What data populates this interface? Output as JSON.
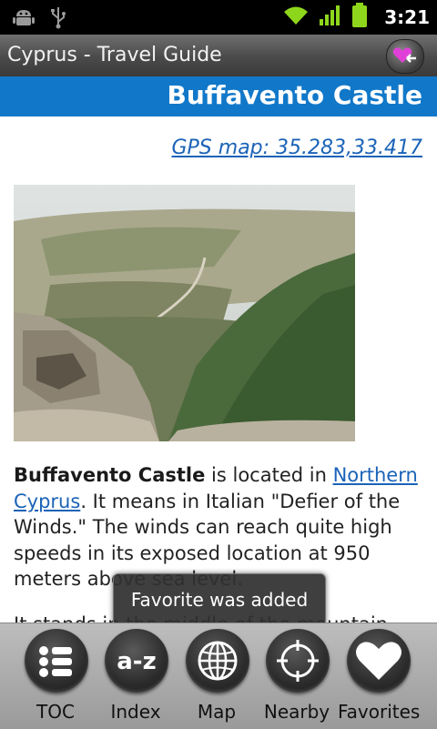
{
  "status_bar": {
    "time": "3:21",
    "icons": [
      "android-debug-icon",
      "usb-icon",
      "wifi-icon",
      "signal-icon",
      "battery-icon"
    ]
  },
  "app_bar": {
    "title": "Cyprus - Travel Guide",
    "favorite_button_icon": "heart-arrow-icon"
  },
  "page": {
    "title": "Buffavento Castle",
    "gps_link": "GPS map: 35.283,33.417",
    "photo_alt": "Buffavento Castle ruins on mountain ridge",
    "article": {
      "bold_name": "Buffavento Castle",
      "text1": " is located in ",
      "link_text": "Northern Cyprus",
      "text2": ". It means in Italian \"Defier of the Winds.\" The winds can reach quite high speeds in its exposed location at 950 meters above sea level.",
      "text3": "It stands in the middle of the mountain"
    }
  },
  "toast": {
    "message": "Favorite was added"
  },
  "toolbar": {
    "items": [
      {
        "label": "TOC",
        "icon": "list-icon"
      },
      {
        "label": "Index",
        "icon": "a-z-icon"
      },
      {
        "label": "Map",
        "icon": "globe-icon"
      },
      {
        "label": "Nearby",
        "icon": "crosshair-icon"
      },
      {
        "label": "Favorites",
        "icon": "heart-icon"
      }
    ]
  },
  "colors": {
    "header_blue": "#1178c9",
    "link_blue": "#1b63b8",
    "status_green": "#8ed61c"
  }
}
